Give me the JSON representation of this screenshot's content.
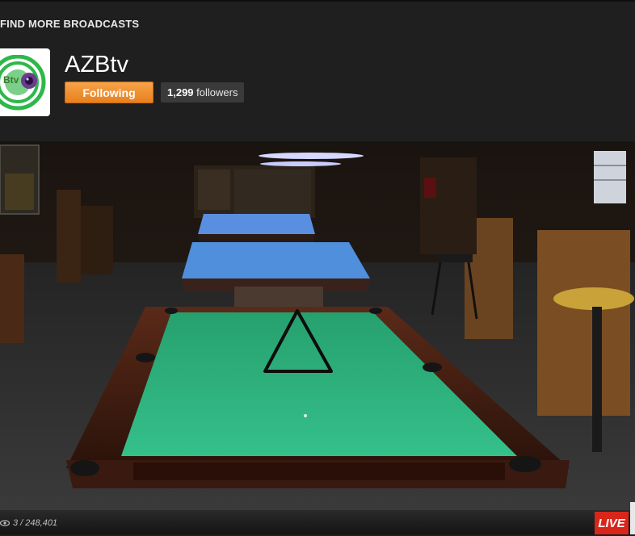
{
  "header": {
    "find_more_label": "FIND MORE BROADCASTS"
  },
  "channel": {
    "logo_text": "Btv",
    "name": "AZBtv",
    "follow_button_label": "Following",
    "followers_count": "1,299",
    "followers_label": "followers"
  },
  "player": {
    "viewer_stats": "3 / 248,401",
    "live_badge": "LIVE",
    "icons": [
      "eye-icon"
    ]
  },
  "colors": {
    "background": "#1f1f1f",
    "follow_button": "#f0922f",
    "live_badge": "#d8261b",
    "felt_green": "#2fb07a",
    "felt_blue": "#4f8fdc"
  }
}
